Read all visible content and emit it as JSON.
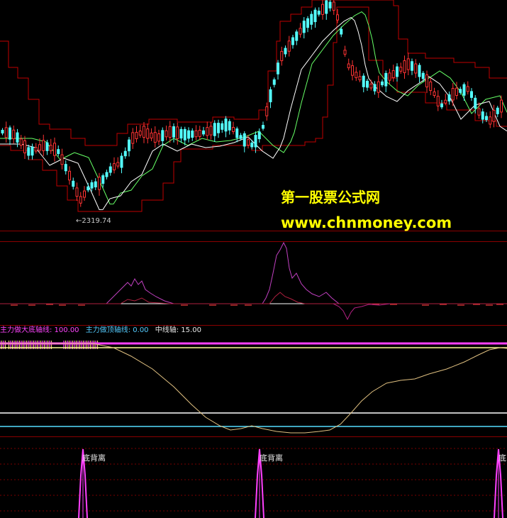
{
  "watermark": {
    "line1": "第一股票公式网",
    "line2": "www.chnmoney.com"
  },
  "price_panel": {
    "low_label": "←2319.74"
  },
  "indicator_legend": {
    "bottom_line": "主力做大底轴线: 100.00",
    "top_line": "主力做顶轴线: 0.00",
    "mid_line": "中线轴: 15.00"
  },
  "divergence_signals": {
    "label": "底背离",
    "partial_label": "底"
  },
  "colors": {
    "background": "#000000",
    "up_candle": "#ff3333",
    "down_candle": "#54ffff",
    "ma_white": "#ffffff",
    "ma_green": "#66ff66",
    "channel": "#c00000",
    "magenta": "#ff40ff",
    "yellow_line": "#ffff99",
    "cyan_line": "#55ddff",
    "watermark": "#ffff00"
  }
}
